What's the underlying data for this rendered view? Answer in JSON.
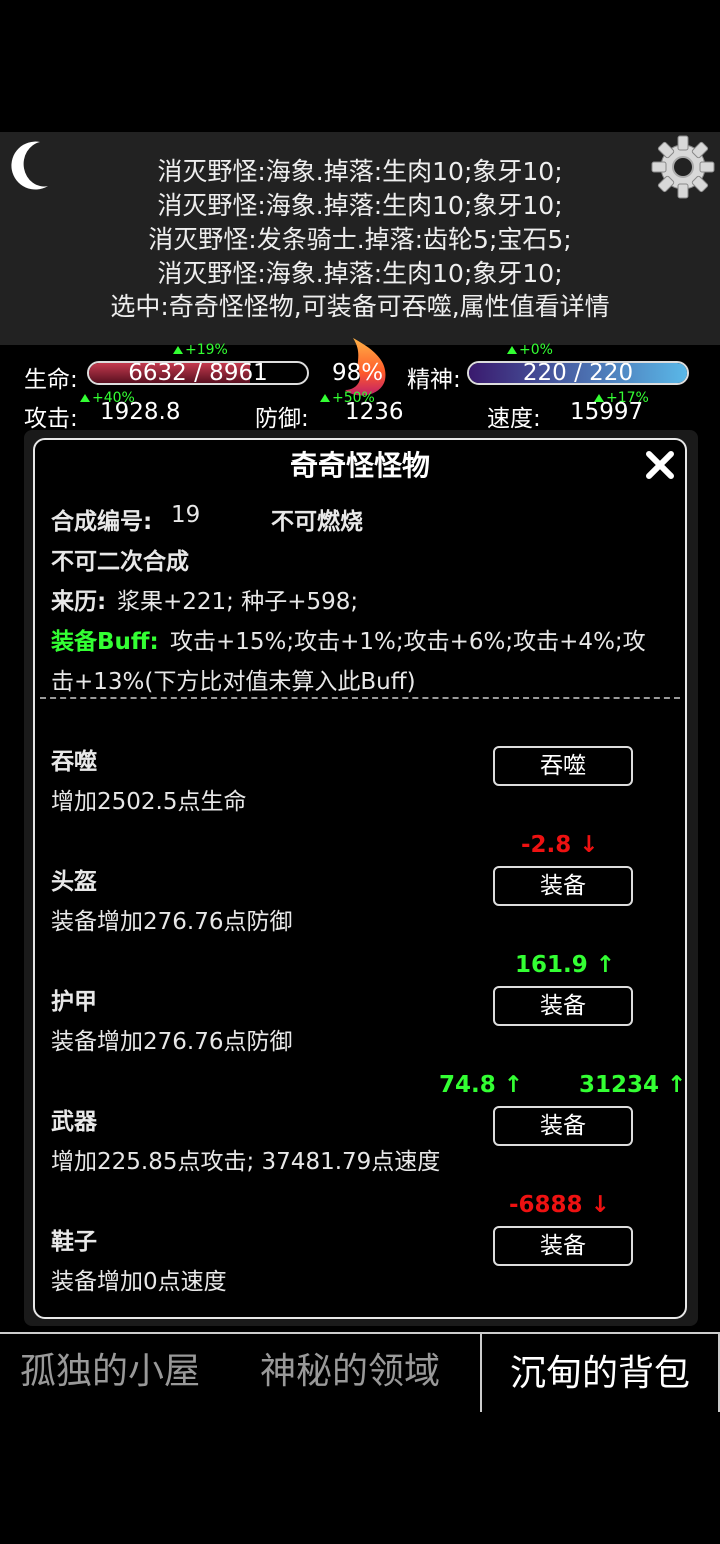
{
  "log": {
    "lines": [
      "消灭野怪:海象.掉落:生肉10;象牙10;",
      "消灭野怪:海象.掉落:生肉10;象牙10;",
      "消灭野怪:发条骑士.掉落:齿轮5;宝石5;",
      "消灭野怪:海象.掉落:生肉10;象牙10;",
      "选中:奇奇怪怪物,可装备可吞噬,属性值看详情"
    ]
  },
  "icons": {
    "moon": "moon-icon",
    "settings": "gear-icon",
    "fire": "flame-icon",
    "close": "close-icon"
  },
  "stats": {
    "hp_label": "生命:",
    "hp_text": "6632 / 8961",
    "hp_fraction": 0.74,
    "hp_bonus": "+19%",
    "fire_percent": "98%",
    "mp_label": "精神:",
    "mp_text": "220 / 220",
    "mp_fraction": 1.0,
    "mp_bonus": "+0%",
    "atk_label": "攻击:",
    "atk_value": "1928.8",
    "atk_bonus": "+40%",
    "def_label": "防御:",
    "def_value": "1236",
    "def_bonus": "+50%",
    "spd_label": "速度:",
    "spd_value": "15997",
    "spd_bonus": "+17%"
  },
  "item": {
    "title": "奇奇怪怪物",
    "synth_label": "合成编号:",
    "synth_value": "19",
    "burn": "不可燃烧",
    "resynth": "不可二次合成",
    "origin_label": "来历:",
    "origin_value": "浆果+221; 种子+598;",
    "buff_label": "装备Buff:",
    "buff_value_line1": "攻击+15%;攻击+1%;攻击+6%;攻击+4%;攻",
    "buff_value_line2": "击+13%(下方比对值未算入此Buff)"
  },
  "actions": [
    {
      "name": "吞噬",
      "desc": "增加2502.5点生命",
      "button": "吞噬"
    },
    {
      "name": "头盔",
      "desc": "装备增加276.76点防御",
      "button": "装备",
      "cmp": "-2.8 ↓"
    },
    {
      "name": "护甲",
      "desc": "装备增加276.76点防御",
      "button": "装备",
      "cmp": "161.9 ↑"
    },
    {
      "name": "武器",
      "desc": "增加225.85点攻击; 37481.79点速度",
      "button": "装备",
      "cmp": "74.8 ↑",
      "cmp2": "31234 ↑"
    },
    {
      "name": "鞋子",
      "desc": "装备增加0点速度",
      "button": "装备",
      "cmp": "-6888 ↓"
    }
  ],
  "tabs": [
    "孤独的小屋",
    "神秘的领域",
    "沉甸的背包"
  ],
  "colors": {
    "hp_bar": "#7a1e2e",
    "mp_bar_start": "#3a1a6e",
    "mp_bar_end": "#5ab8e8",
    "up": "#33ff33",
    "down": "#ee1111"
  }
}
